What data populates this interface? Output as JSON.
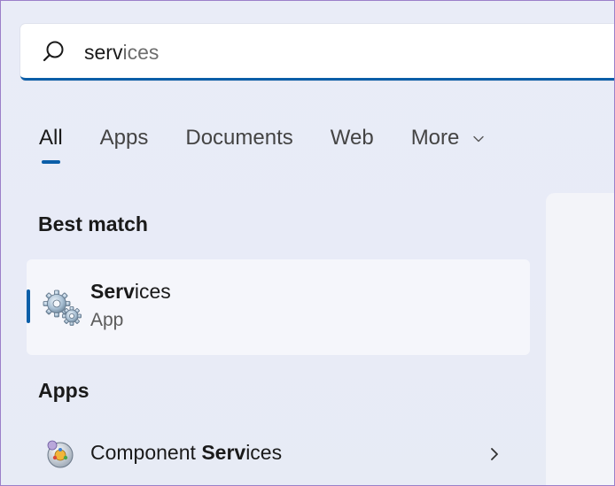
{
  "search": {
    "typed": "serv",
    "suggestion": "ices"
  },
  "tabs": [
    {
      "label": "All",
      "active": true
    },
    {
      "label": "Apps",
      "active": false
    },
    {
      "label": "Documents",
      "active": false
    },
    {
      "label": "Web",
      "active": false
    },
    {
      "label": "More",
      "active": false
    }
  ],
  "best_match": {
    "heading": "Best match",
    "app_name_bold": "Serv",
    "app_name_rest": "ices",
    "app_type": "App"
  },
  "apps": {
    "heading": "Apps",
    "items": [
      {
        "name_prefix": "Component ",
        "name_bold": "Serv",
        "name_rest": "ices"
      }
    ]
  },
  "colors": {
    "accent": "#0b5ea8",
    "background": "#e8ebf7"
  },
  "icons": {
    "search": "search-icon",
    "more_chevron": "chevron-down-icon",
    "services_app": "gears-icon",
    "component_services": "component-services-icon",
    "open_chevron": "chevron-right-icon"
  }
}
